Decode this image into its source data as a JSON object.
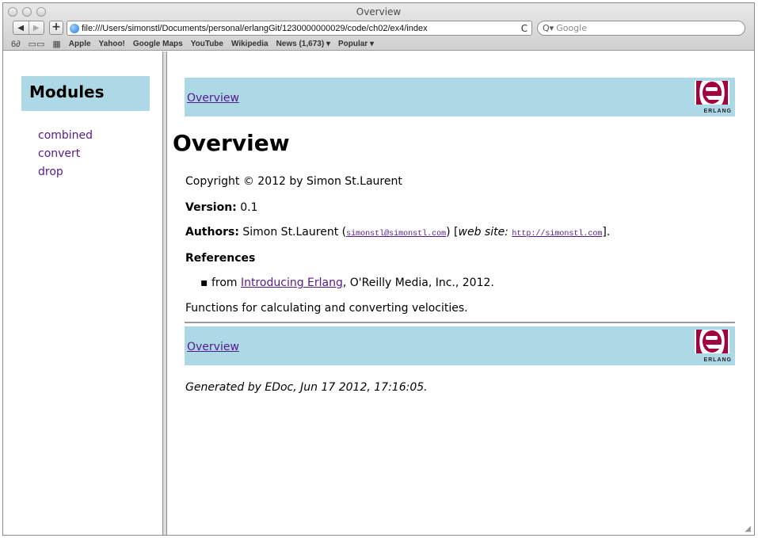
{
  "window": {
    "title": "Overview"
  },
  "toolbar": {
    "back_icon": "◀",
    "forward_icon": "▶",
    "add_icon": "+",
    "url": "file:///Users/simonstl/Documents/personal/erlangGit/1230000000029/code/ch02/ex4/index",
    "reload_icon": "C",
    "search_placeholder": "Google",
    "search_icon_glyph": "Q▾"
  },
  "bookmarks": {
    "reader_icon": "6∂",
    "book_icon": "▭▭",
    "grid_icon": "▦",
    "items": [
      "Apple",
      "Yahoo!",
      "Google Maps",
      "YouTube",
      "Wikipedia",
      "News (1,673) ▾",
      "Popular ▾"
    ]
  },
  "sidebar": {
    "title": "Modules",
    "modules": [
      "combined",
      "convert",
      "drop"
    ]
  },
  "main": {
    "nav_link": "Overview",
    "logo_text": "ERLANG",
    "heading": "Overview",
    "copyright": "Copyright © 2012 by Simon St.Laurent",
    "version_label": "Version:",
    "version_value": "0.1",
    "authors_label": "Authors:",
    "author_name": "Simon St.Laurent (",
    "author_email": "simonstl@simonstl.com",
    "website_pre": ") [",
    "website_label": "web site:",
    "website_url": "http://simonstl.com",
    "website_post": "].",
    "references_label": "References",
    "reference_pre": "from ",
    "reference_link": "Introducing Erlang",
    "reference_post": ", O'Reilly Media, Inc., 2012.",
    "description": "Functions for calculating and converting velocities.",
    "generated": "Generated by EDoc, Jun 17 2012, 17:16:05."
  },
  "colors": {
    "nav_bg": "#add8e6",
    "link": "#551a8b",
    "logo_red": "#a2003e"
  }
}
